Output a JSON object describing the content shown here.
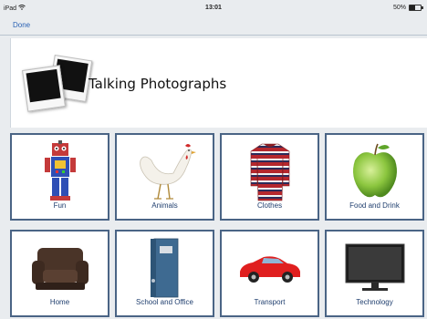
{
  "status_bar": {
    "device": "iPad",
    "time": "13:01",
    "battery": "50%",
    "battery_level": 0.5
  },
  "nav": {
    "done_label": "Done"
  },
  "header": {
    "title": "Talking Photographs"
  },
  "categories": [
    {
      "label": "Fun",
      "icon": "robot-icon"
    },
    {
      "label": "Animals",
      "icon": "chicken-icon"
    },
    {
      "label": "Clothes",
      "icon": "sweater-icon"
    },
    {
      "label": "Food and Drink",
      "icon": "apple-icon"
    },
    {
      "label": "Home",
      "icon": "armchair-icon"
    },
    {
      "label": "School and Office",
      "icon": "binder-icon"
    },
    {
      "label": "Transport",
      "icon": "car-icon"
    },
    {
      "label": "Technology",
      "icon": "television-icon"
    }
  ]
}
